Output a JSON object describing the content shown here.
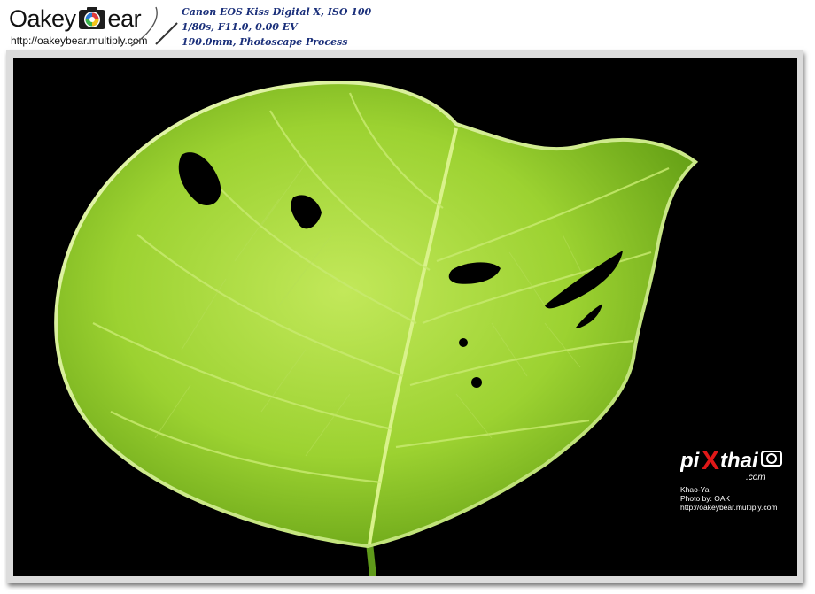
{
  "header": {
    "logo": {
      "text_left": "Oakey",
      "text_right": "ear",
      "icon": "camera-lens-icon",
      "url": "http://oakeybear.multiply.com"
    },
    "exif": {
      "line1": "Canon EOS Kiss Digital X, ISO 100",
      "line2": "1/80s, F11.0, 0.00 EV",
      "line3": "190.0mm, Photoscape Process"
    }
  },
  "photo": {
    "subject": "backlit-green-leaf",
    "background_color": "#000000",
    "leaf_color": "#9cd231"
  },
  "watermark": {
    "logo_text": "piXthai",
    "logo_sub": ".com",
    "icon": "camera-icon",
    "location": "Khao-Yai",
    "credit": "Photo by: OAK",
    "url": "http://oakeybear.multiply.com"
  },
  "colors": {
    "exif_text": "#1a2f7a",
    "frame": "#dcdcdc",
    "watermark_red": "#e01818"
  }
}
